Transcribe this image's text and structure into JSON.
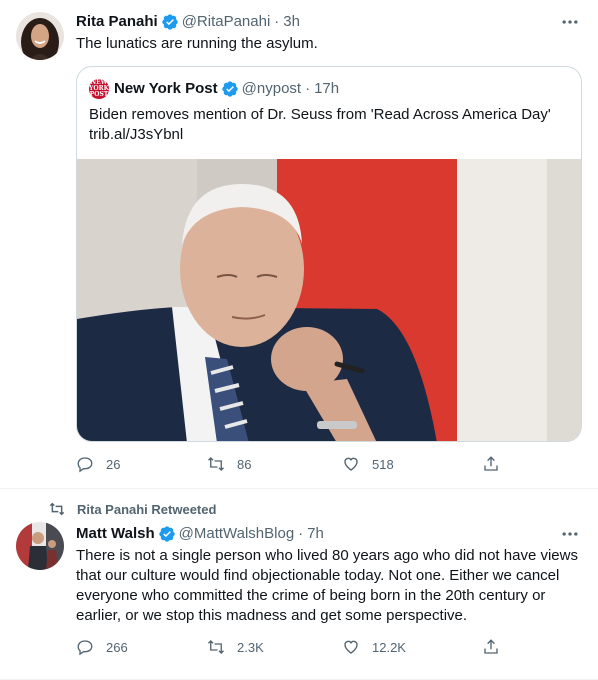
{
  "tweet1": {
    "name": "Rita Panahi",
    "handle": "@RitaPanahi",
    "time": "3h",
    "separator": "·",
    "text": "The lunatics are running the asylum.",
    "quote": {
      "logo_line1": "NEW",
      "logo_line2": "YORK",
      "logo_line3": "POST",
      "name": "New York Post",
      "handle": "@nypost",
      "time": "17h",
      "text": "Biden removes mention of Dr. Seuss from 'Read Across America Day'",
      "link": "trib.al/J3sYbnl"
    },
    "actions": {
      "replies": "26",
      "retweets": "86",
      "likes": "518"
    }
  },
  "retweet_banner": "Rita Panahi Retweeted",
  "tweet2": {
    "name": "Matt Walsh",
    "handle": "@MattWalshBlog",
    "time": "7h",
    "separator": "·",
    "text": "There is not a single person who lived 80 years ago who did not have views that our culture would find objectionable today. Not one. Either we cancel everyone who committed the crime of being born in the 20th century or earlier, or we stop this madness and get some perspective.",
    "actions": {
      "replies": "266",
      "retweets": "2.3K",
      "likes": "12.2K"
    }
  },
  "colors": {
    "verified": "#1d9bf0",
    "muted": "#536471",
    "border": "#cfd9de"
  },
  "icons": [
    "verified-icon",
    "more-icon",
    "reply-icon",
    "retweet-icon",
    "like-icon",
    "share-icon"
  ]
}
